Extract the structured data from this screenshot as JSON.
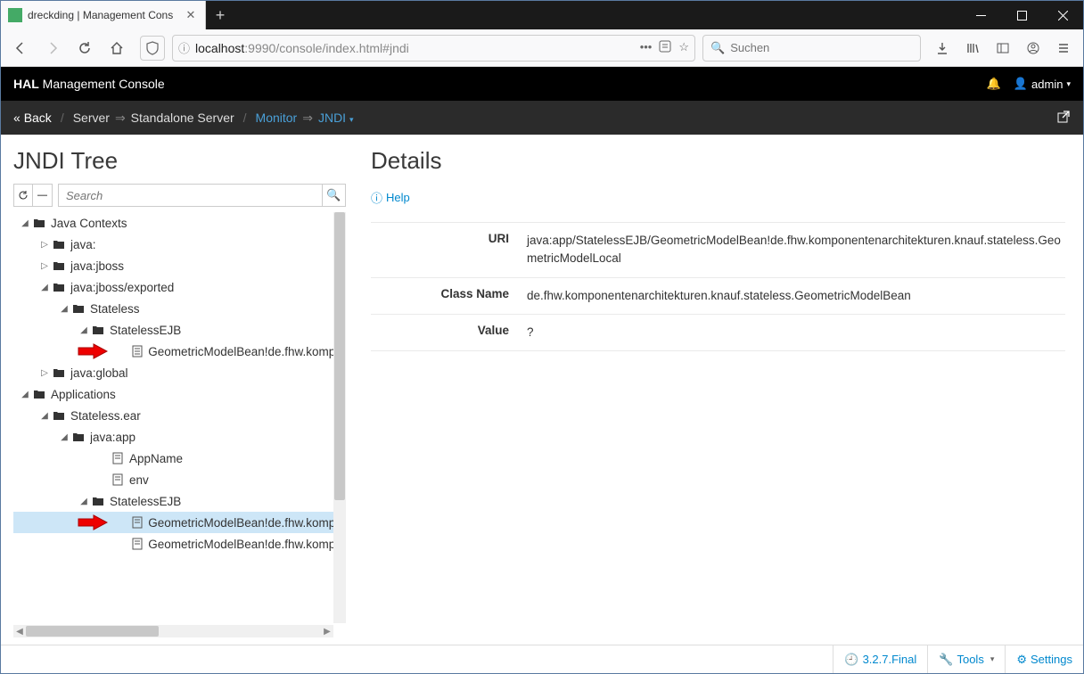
{
  "browser": {
    "tab_title": "dreckding | Management Cons",
    "url_host": "localhost",
    "url_port": ":9990",
    "url_path": "/console/index.html#jndi",
    "search_placeholder": "Suchen"
  },
  "appbar": {
    "brand_bold": "HAL",
    "brand_rest": " Management Console",
    "user": "admin"
  },
  "breadcrumb": {
    "back": "Back",
    "server": "Server",
    "standalone": "Standalone Server",
    "monitor": "Monitor",
    "jndi": "JNDI"
  },
  "left": {
    "title": "JNDI Tree",
    "search_placeholder": "Search",
    "tree": {
      "java_contexts": "Java Contexts",
      "java": "java:",
      "java_jboss": "java:jboss",
      "java_jboss_exported": "java:jboss/exported",
      "stateless": "Stateless",
      "stateless_ejb": "StatelessEJB",
      "bean1": "GeometricModelBean!de.fhw.kompo",
      "java_global": "java:global",
      "applications": "Applications",
      "stateless_ear": "Stateless.ear",
      "java_app": "java:app",
      "appname": "AppName",
      "env": "env",
      "stateless_ejb2": "StatelessEJB",
      "bean2": "GeometricModelBean!de.fhw.kompo",
      "bean3": "GeometricModelBean!de.fhw.kompo"
    }
  },
  "right": {
    "title": "Details",
    "help": "Help",
    "rows": {
      "uri_label": "URI",
      "uri_value": "java:app/StatelessEJB/GeometricModelBean!de.fhw.komponentenarchitekturen.knauf.stateless.GeometricModelLocal",
      "class_label": "Class Name",
      "class_value": "de.fhw.komponentenarchitekturen.knauf.stateless.GeometricModelBean",
      "value_label": "Value",
      "value_value": "?"
    }
  },
  "footer": {
    "version": "3.2.7.Final",
    "tools": "Tools",
    "settings": "Settings"
  }
}
